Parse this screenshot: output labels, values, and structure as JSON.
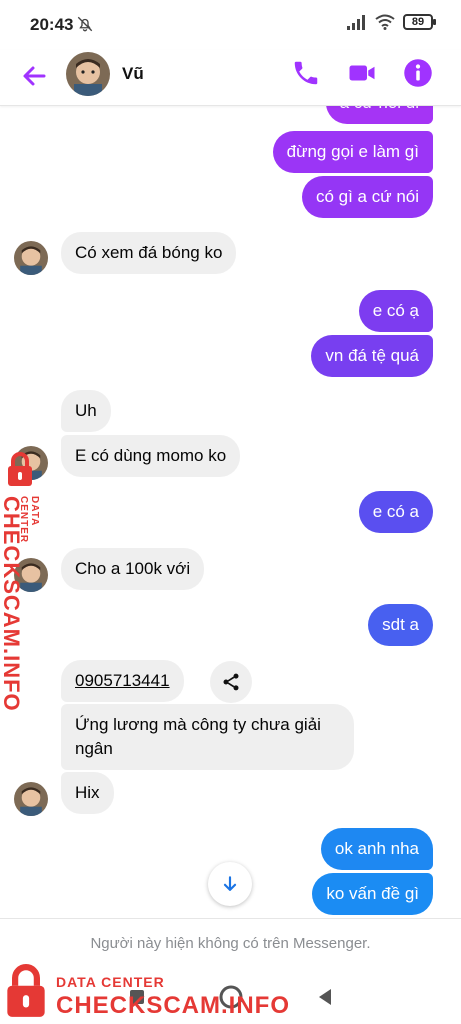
{
  "status_bar": {
    "time": "20:43",
    "battery": "89"
  },
  "header": {
    "contact_name": "Vũ",
    "icons": [
      "back-arrow-icon",
      "phone-icon",
      "video-icon",
      "info-icon"
    ],
    "accent_color": "#a033ff"
  },
  "messages": [
    {
      "side": "out",
      "text": "a cứ nói đi",
      "color": "#a534f5"
    },
    {
      "side": "out",
      "text": "đừng gọi e làm gì",
      "color": "#9b35f6"
    },
    {
      "side": "out",
      "text": "có gì a cứ nói",
      "color": "#9536f5"
    },
    {
      "side": "in",
      "text": "Có xem đá bóng ko"
    },
    {
      "side": "out",
      "text": "e có ạ",
      "color": "#7d3cf0"
    },
    {
      "side": "out",
      "text": "vn đá tệ quá",
      "color": "#783ff0"
    },
    {
      "side": "in",
      "text": "Uh"
    },
    {
      "side": "in",
      "text": "E có dùng momo ko"
    },
    {
      "side": "out",
      "text": "e có a",
      "color": "#5a4ff0"
    },
    {
      "side": "in",
      "text": "Cho a 100k với"
    },
    {
      "side": "out",
      "text": "sdt a",
      "color": "#4860f0"
    },
    {
      "side": "in",
      "text": "0905713441",
      "is_link": true
    },
    {
      "side": "in",
      "text": "Ứng lương mà công ty chưa giải\nngân"
    },
    {
      "side": "in",
      "text": "Hix"
    },
    {
      "side": "out",
      "text": "ok anh nha",
      "color": "#1e88f2"
    },
    {
      "side": "out",
      "text": "ko vấn đề gì",
      "color": "#1b8cf3"
    }
  ],
  "footer": {
    "notice": "Người này hiện không có trên Messenger."
  },
  "watermark": {
    "small": "DATA CENTER",
    "big": "CHECKSCAM.INFO",
    "color": "#e53935"
  }
}
